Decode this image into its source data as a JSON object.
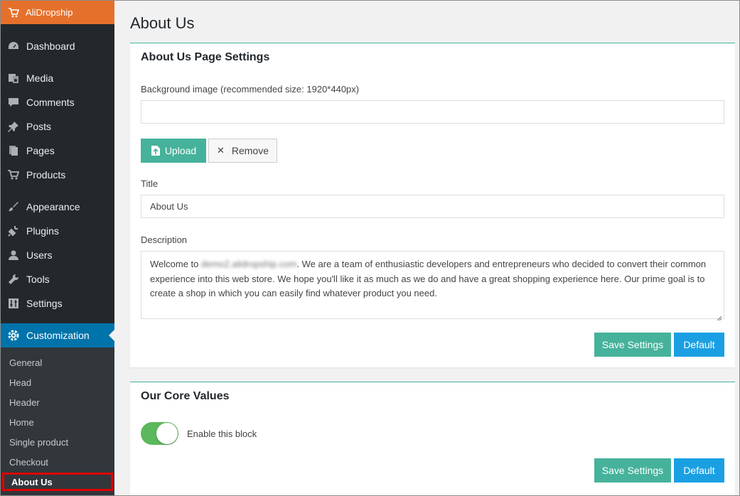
{
  "sidebar": {
    "brand": "AliDropship",
    "items": [
      {
        "label": "Dashboard",
        "icon": "dashboard-icon"
      },
      {
        "label": "Media",
        "icon": "media-icon"
      },
      {
        "label": "Comments",
        "icon": "comments-icon"
      },
      {
        "label": "Posts",
        "icon": "pin-icon"
      },
      {
        "label": "Pages",
        "icon": "pages-icon"
      },
      {
        "label": "Products",
        "icon": "cart-icon"
      },
      {
        "label": "Appearance",
        "icon": "brush-icon"
      },
      {
        "label": "Plugins",
        "icon": "plugin-icon"
      },
      {
        "label": "Users",
        "icon": "user-icon"
      },
      {
        "label": "Tools",
        "icon": "wrench-icon"
      },
      {
        "label": "Settings",
        "icon": "sliders-icon"
      },
      {
        "label": "Customization",
        "icon": "gear-icon"
      }
    ],
    "submenu": [
      "General",
      "Head",
      "Header",
      "Home",
      "Single product",
      "Checkout",
      "About Us"
    ],
    "active_submenu": "About Us"
  },
  "main": {
    "page_title": "About Us",
    "settings_panel": {
      "title": "About Us Page Settings",
      "background_label": "Background image (recommended size: 1920*440px)",
      "background_value": "",
      "upload_label": "Upload",
      "remove_label": "Remove",
      "title_label": "Title",
      "title_value": "About Us",
      "description_label": "Description",
      "description_prefix": "Welcome to ",
      "description_domain": "demo2.alidropship.com",
      "description_rest": ". We are a team of enthusiastic developers and entrepreneurs who decided to convert their common experience into this web store. We hope you'll like it as much as we do and have a great shopping experience here. Our prime goal is to create a shop in which you can easily find whatever product you need.",
      "save_label": "Save Settings",
      "default_label": "Default"
    },
    "core_values_panel": {
      "title": "Our Core Values",
      "toggle_label": "Enable this block",
      "toggle_on": true,
      "save_label": "Save Settings",
      "default_label": "Default"
    }
  },
  "colors": {
    "sidebar_bg": "#23282d",
    "brand_bg": "#e5702b",
    "active_bg": "#0073aa",
    "save_btn": "#46b29b",
    "default_btn": "#1aa0e2",
    "toggle_on": "#5cb85c",
    "highlight_box": "#e00000"
  }
}
